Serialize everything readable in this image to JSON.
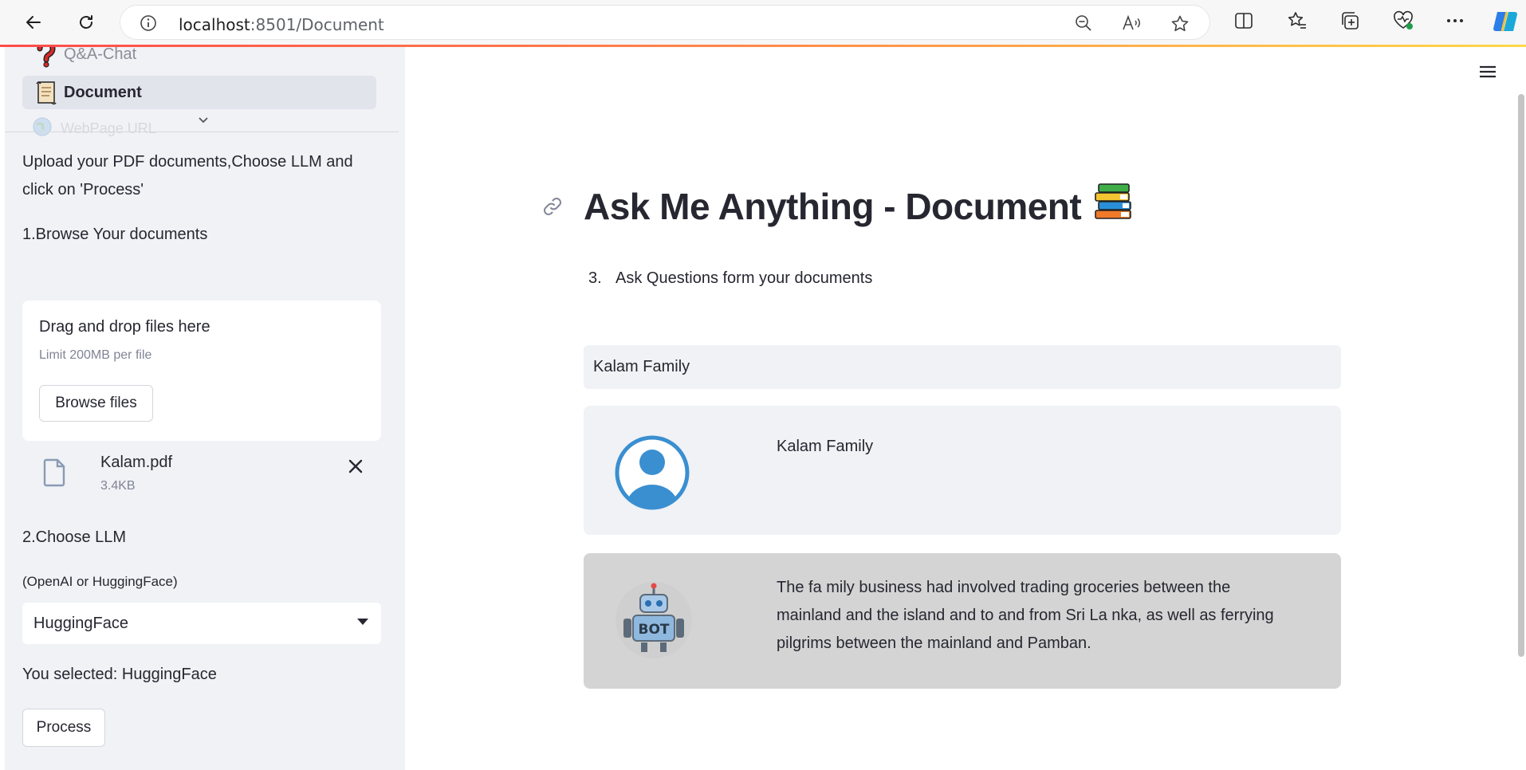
{
  "browser": {
    "url_host": "localhost",
    "url_path": ":8501/Document"
  },
  "sidebar": {
    "nav_items": [
      {
        "label": "Q&A-Chat"
      },
      {
        "label": "Document"
      },
      {
        "label": "WebPage URL"
      }
    ],
    "instructions": "Upload your PDF documents,Choose LLM and click on 'Process'",
    "step1_label": "1.Browse Your documents",
    "uploader": {
      "title": "Drag and drop files here",
      "limit": "Limit 200MB per file",
      "browse_label": "Browse files"
    },
    "file": {
      "name": "Kalam.pdf",
      "size": "3.4KB"
    },
    "step2_label": "2.Choose LLM",
    "llm_hint": "(OpenAI or HuggingFace)",
    "llm_select": {
      "value": "HuggingFace"
    },
    "selected_text": "You selected: HuggingFace",
    "process_label": "Process"
  },
  "main": {
    "title": "Ask Me Anything - Document",
    "step3": {
      "number": "3.",
      "text": "Ask Questions form your documents"
    },
    "question_input": {
      "value": "Kalam Family"
    },
    "messages": [
      {
        "role": "user",
        "text": "Kalam Family"
      },
      {
        "role": "bot",
        "text": "The fa mily business had involved trading groceries between the mainland and the island and to and from Sri La nka, as well as ferrying pilgrims between the mainland and Pamban."
      }
    ]
  },
  "colors": {
    "sidebar_bg": "#f0f2f6",
    "accent_red": "#ff4b4b",
    "user_msg_bg": "#f0f2f6",
    "bot_msg_bg": "#d4d4d4",
    "avatar_blue": "#3a8fd1"
  }
}
